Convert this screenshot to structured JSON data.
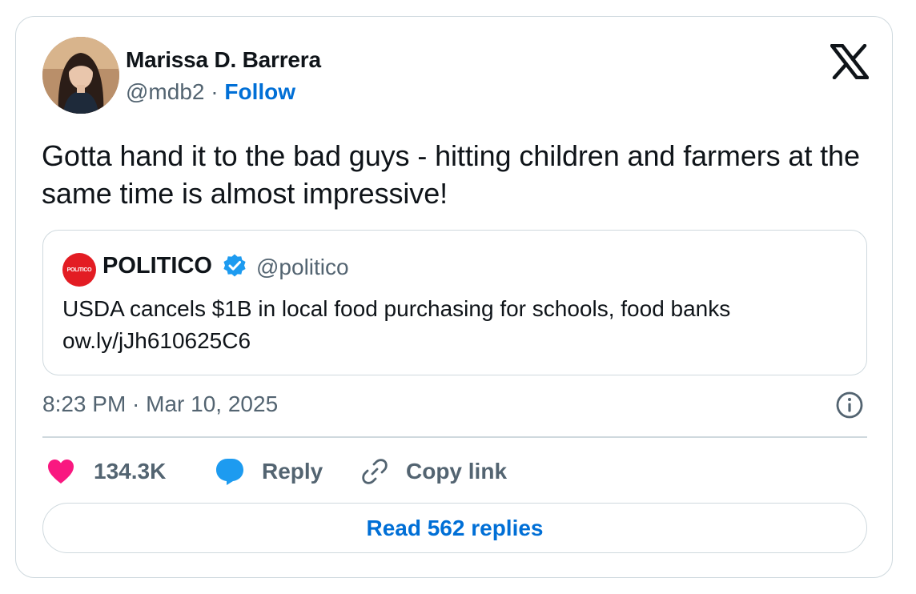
{
  "author": {
    "name": "Marissa D. Barrera",
    "handle": "@mdb2",
    "separator": "·",
    "follow_label": "Follow"
  },
  "platform_icon": "x-logo-icon",
  "tweet": {
    "text": "Gotta hand it to the bad guys - hitting children and farmers at the same time is almost impressive!"
  },
  "quoted": {
    "logo_text": "POLITICO",
    "name": "POLITICO",
    "verified_icon": "verified-badge-icon",
    "handle": "@politico",
    "text_line1": "USDA cancels $1B in local food purchasing for schools, food banks",
    "text_line2": "ow.ly/jJh610625C6"
  },
  "timestamp": "8:23 PM · Mar 10, 2025",
  "actions": {
    "likes_count": "134.3K",
    "reply_label": "Reply",
    "copy_link_label": "Copy link"
  },
  "read_replies_label": "Read 562 replies",
  "colors": {
    "link_blue": "#006fd6",
    "like_pink": "#f91880",
    "reply_blue": "#1d9bf0",
    "muted_text": "#536471",
    "border": "#cfd9de"
  }
}
